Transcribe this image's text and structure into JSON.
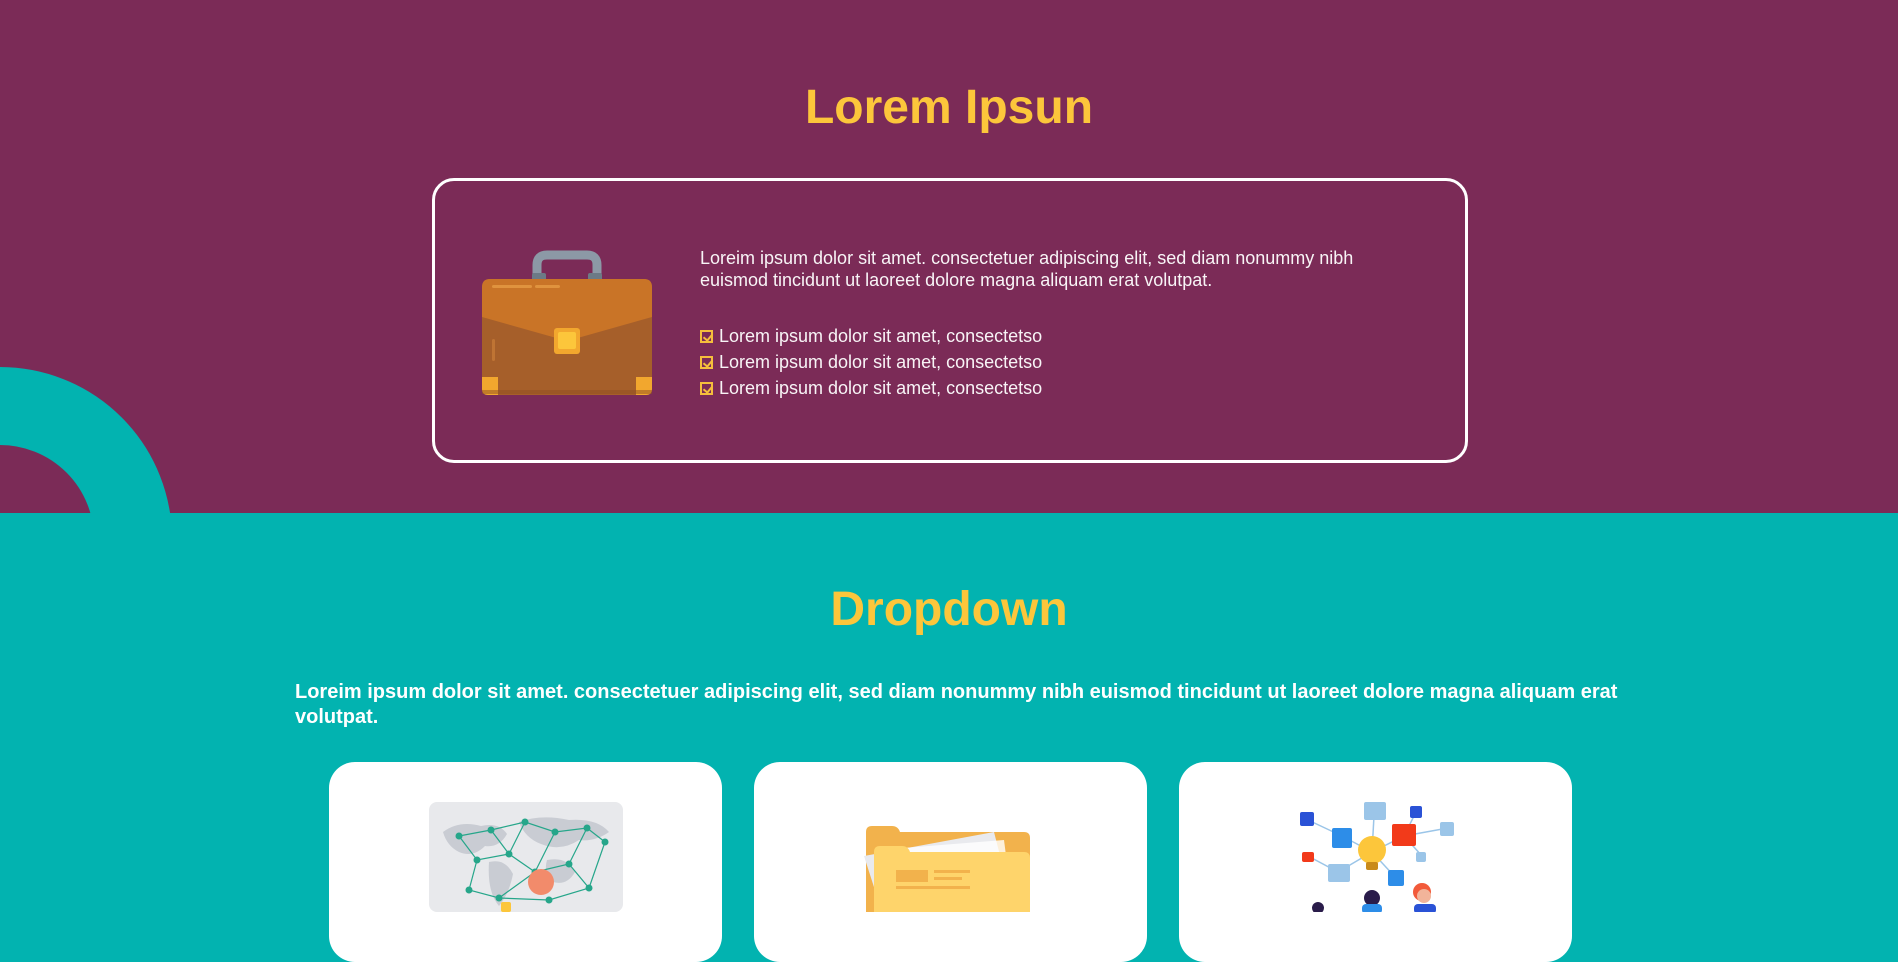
{
  "hero": {
    "title": "Lorem Ipsun",
    "card": {
      "description": "Loreim ipsum dolor sit amet. consectetuer adipiscing elit, sed diam nonummy nibh euismod tincidunt ut laoreet dolore magna aliquam erat volutpat.",
      "checklist": [
        "Lorem ipsum dolor sit amet, consectetso",
        "Lorem ipsum dolor sit amet, consectetso",
        "Lorem ipsum dolor sit amet, consectetso"
      ],
      "icon": "briefcase-icon"
    }
  },
  "dropdown": {
    "title": "Dropdown",
    "intro": "Loreim ipsum dolor sit amet. consectetuer adipiscing elit, sed diam nonummy nibh euismod tincidunt ut laoreet dolore magna aliquam erat volutpat.",
    "cards": [
      {
        "icon": "world-network-icon"
      },
      {
        "icon": "folder-icon"
      },
      {
        "icon": "idea-network-icon"
      }
    ]
  },
  "colors": {
    "top_background": "#7b2b57",
    "bottom_background": "#02b3b0",
    "accent": "#fcc63b",
    "card_background": "#ffffff"
  }
}
